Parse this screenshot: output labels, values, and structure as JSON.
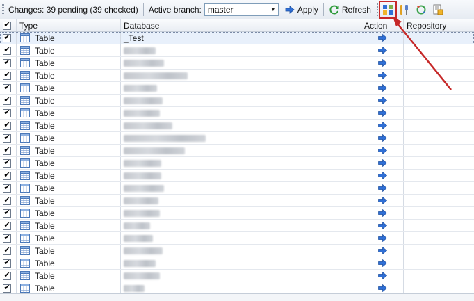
{
  "toolbar": {
    "changes_label": "Changes: 39 pending (39 checked)",
    "branch_label": "Active branch:",
    "branch_value": "master",
    "apply_label": "Apply",
    "refresh_label": "Refresh",
    "icons": [
      "compare-icon",
      "settings-icon",
      "sync-icon",
      "report-icon"
    ]
  },
  "grid": {
    "columns": {
      "check": "",
      "type": "Type",
      "database": "Database",
      "action": "Action",
      "repository": "Repository"
    },
    "rows": [
      {
        "type": "Table",
        "database": "_Test",
        "blurred": false
      },
      {
        "type": "Table",
        "database": "",
        "blurred": true
      },
      {
        "type": "Table",
        "database": "",
        "blurred": true
      },
      {
        "type": "Table",
        "database": "",
        "blurred": true
      },
      {
        "type": "Table",
        "database": "",
        "blurred": true
      },
      {
        "type": "Table",
        "database": "",
        "blurred": true
      },
      {
        "type": "Table",
        "database": "",
        "blurred": true
      },
      {
        "type": "Table",
        "database": "",
        "blurred": true
      },
      {
        "type": "Table",
        "database": "",
        "blurred": true
      },
      {
        "type": "Table",
        "database": "",
        "blurred": true
      },
      {
        "type": "Table",
        "database": "",
        "blurred": true
      },
      {
        "type": "Table",
        "database": "",
        "blurred": true
      },
      {
        "type": "Table",
        "database": "",
        "blurred": true
      },
      {
        "type": "Table",
        "database": "",
        "blurred": true
      },
      {
        "type": "Table",
        "database": "",
        "blurred": true
      },
      {
        "type": "Table",
        "database": "",
        "blurred": true
      },
      {
        "type": "Table",
        "database": "",
        "blurred": true
      },
      {
        "type": "Table",
        "database": "",
        "blurred": true
      },
      {
        "type": "Table",
        "database": "",
        "blurred": true
      },
      {
        "type": "Table",
        "database": "",
        "blurred": true
      },
      {
        "type": "Table",
        "database": "",
        "blurred": true
      }
    ]
  },
  "colors": {
    "annotation": "#c62828",
    "action_arrow": "#2f6fd6",
    "selected_row": "#e8f0fb"
  }
}
